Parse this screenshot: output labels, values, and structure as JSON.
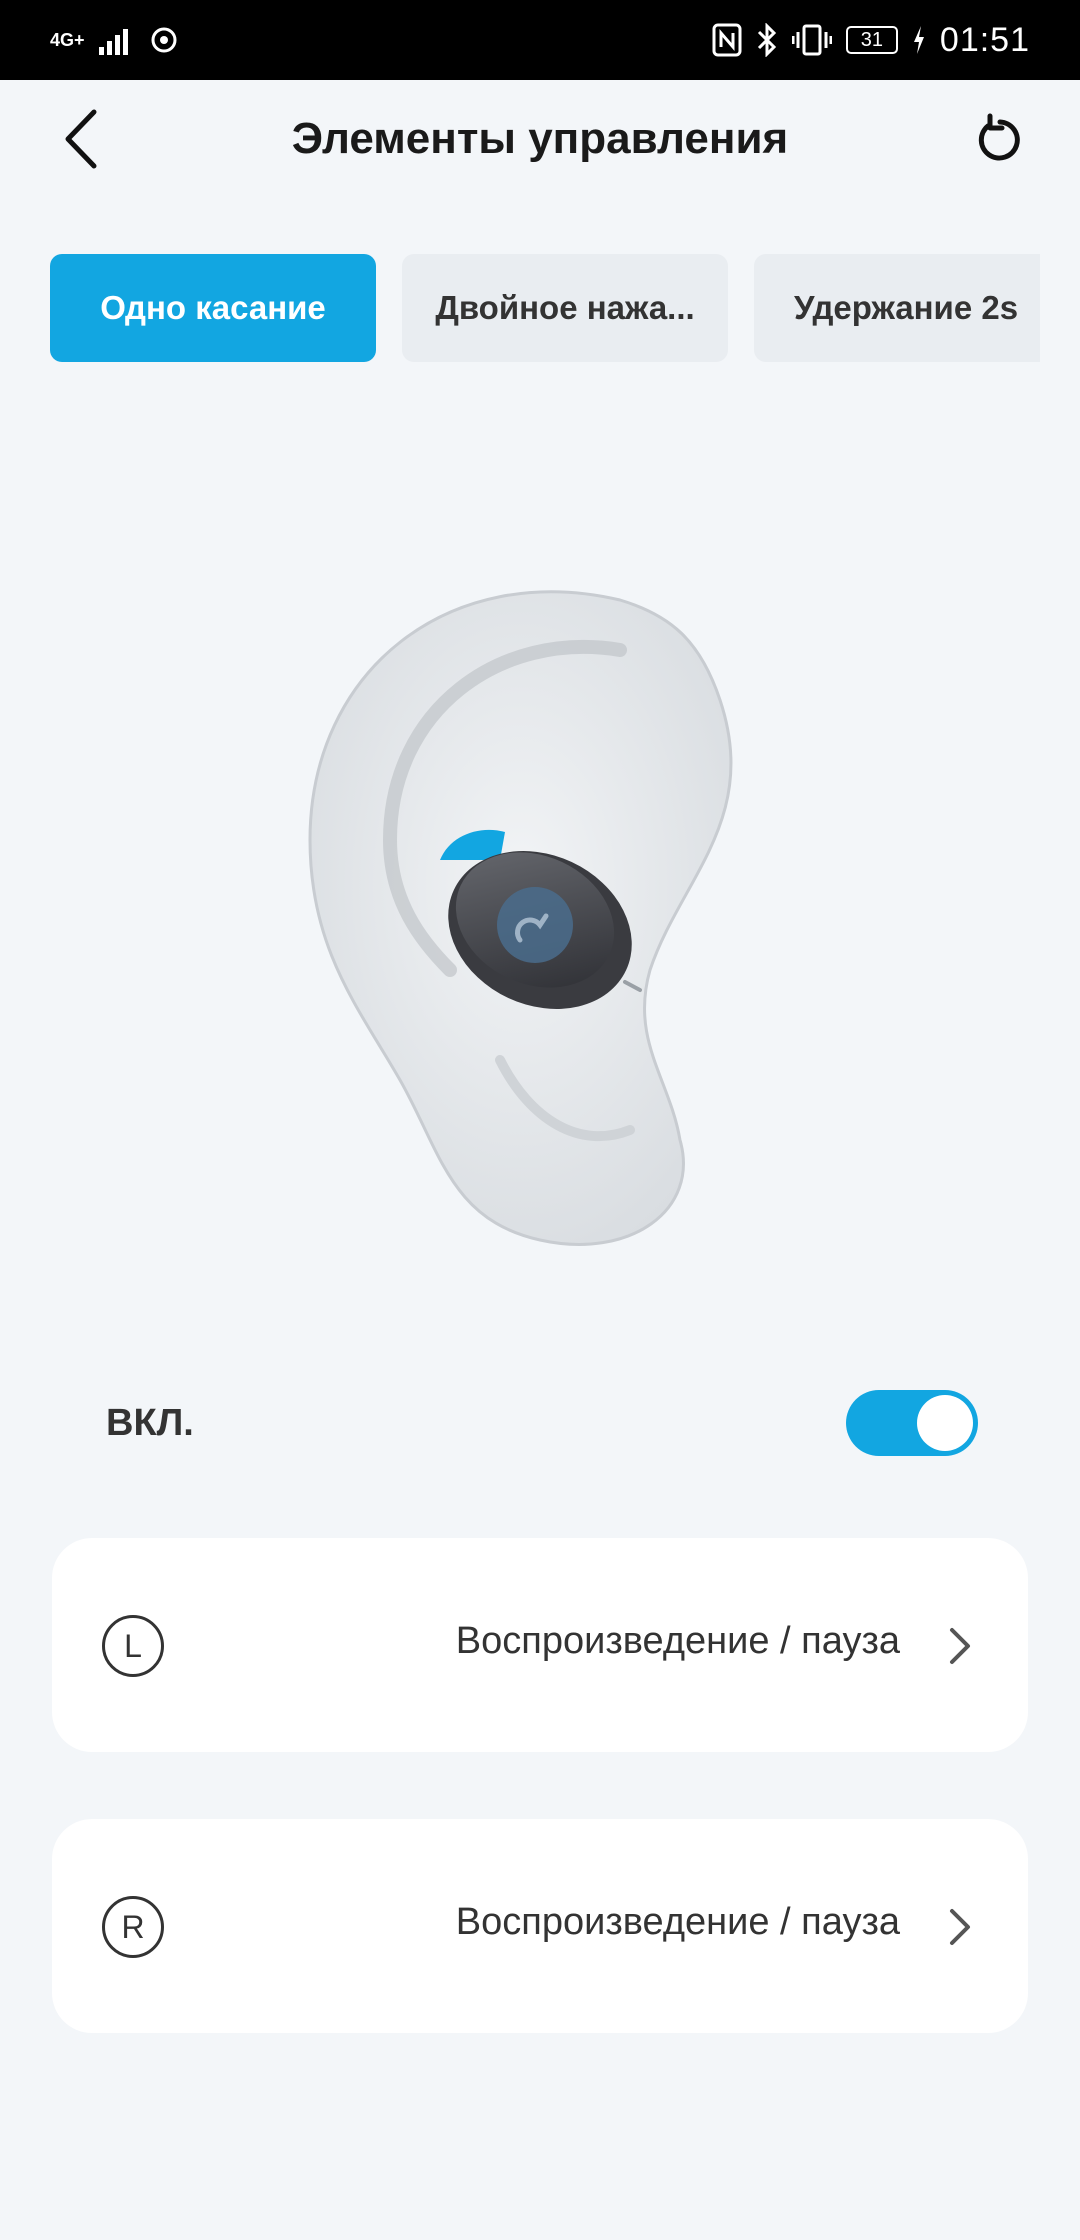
{
  "status_bar": {
    "network": "4G+",
    "battery": "31",
    "time": "01:51"
  },
  "header": {
    "title": "Элементы управления"
  },
  "tabs": [
    {
      "label": "Одно касание",
      "active": true
    },
    {
      "label": "Двойное нажа...",
      "active": false
    },
    {
      "label": "Удержание 2s",
      "active": false
    }
  ],
  "toggle": {
    "label": "ВКЛ.",
    "on": true
  },
  "controls": [
    {
      "side": "L",
      "action": "Воспроизведение / пауза"
    },
    {
      "side": "R",
      "action": "Воспроизведение / пауза"
    }
  ],
  "colors": {
    "accent": "#12a6e1",
    "background": "#f3f6f9"
  }
}
